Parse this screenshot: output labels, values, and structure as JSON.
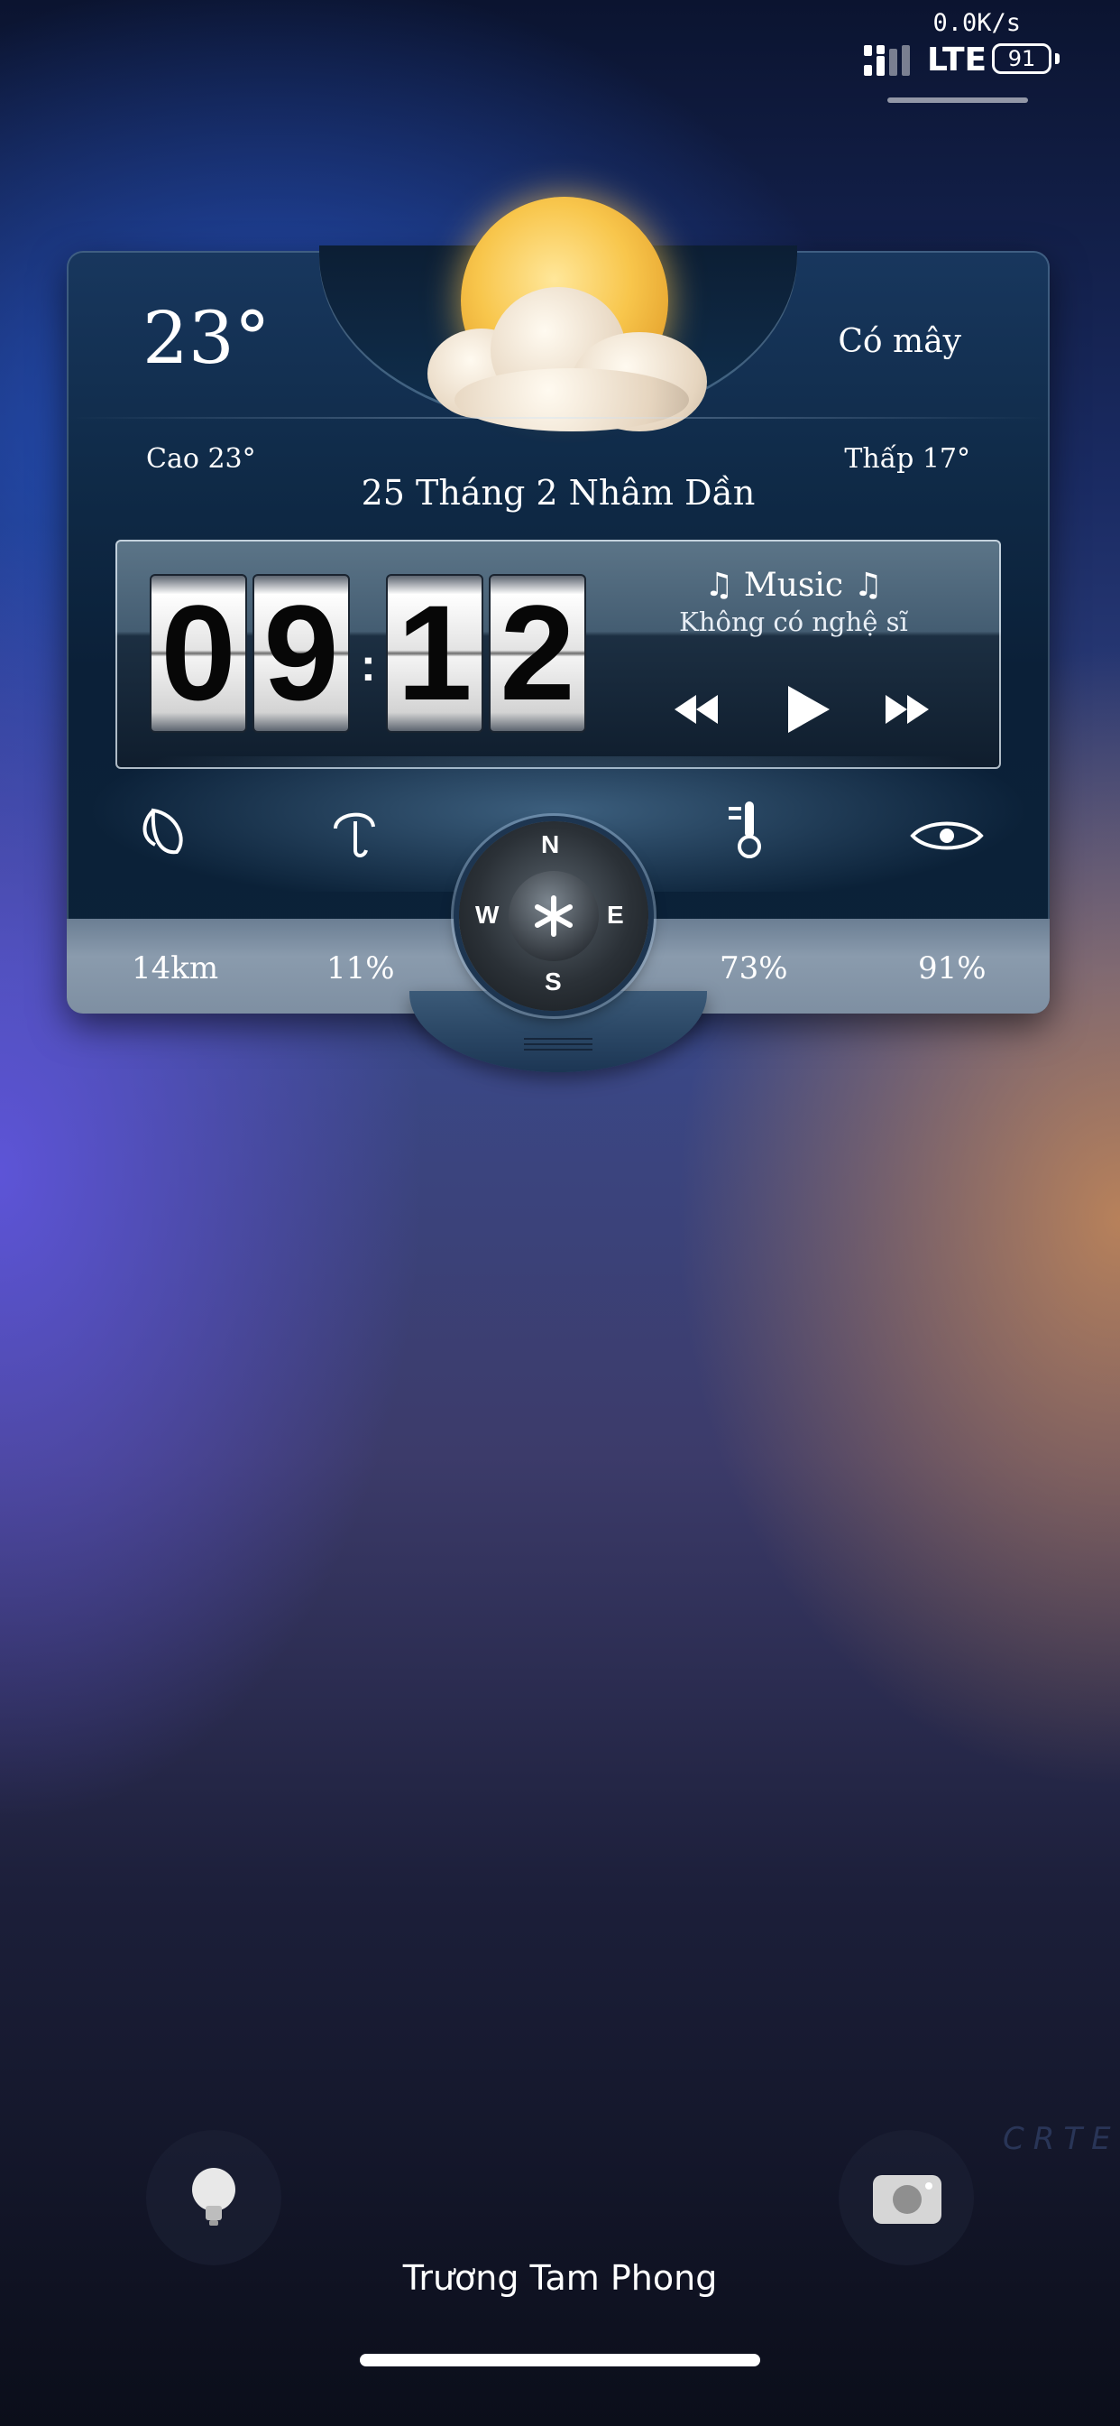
{
  "status_bar": {
    "net_speed": "0.0K/s",
    "network": "LTE",
    "battery": "91",
    "signal_icon": "signal-bars-icon"
  },
  "weather": {
    "temperature": "23°",
    "condition": "Có mây",
    "high": "Cao 23°",
    "low": "Thấp 17°",
    "lunar_date": "25 Tháng 2 Nhâm Dần",
    "icon": "partly-cloudy-icon"
  },
  "clock": {
    "hour_tens": "0",
    "hour_ones": "9",
    "separator": ":",
    "minute_tens": "1",
    "minute_ones": "2"
  },
  "music": {
    "title": "♫ Music ♫",
    "artist": "Không có nghệ sĩ",
    "controls": [
      "rewind-icon",
      "play-icon",
      "fast-forward-icon"
    ]
  },
  "stats": [
    {
      "icon": "wind-leaf-icon",
      "value": "14km"
    },
    {
      "icon": "umbrella-icon",
      "value": "11%"
    },
    {
      "icon": "thermometer-icon",
      "value": "73%"
    },
    {
      "icon": "eye-icon",
      "value": "91%"
    }
  ],
  "compass": {
    "n": "N",
    "e": "E",
    "s": "S",
    "w": "W"
  },
  "dock": {
    "left_icon": "flashlight-icon",
    "right_icon": "camera-icon",
    "owner_name": "Trương Tam Phong"
  },
  "watermark": "CRTE"
}
